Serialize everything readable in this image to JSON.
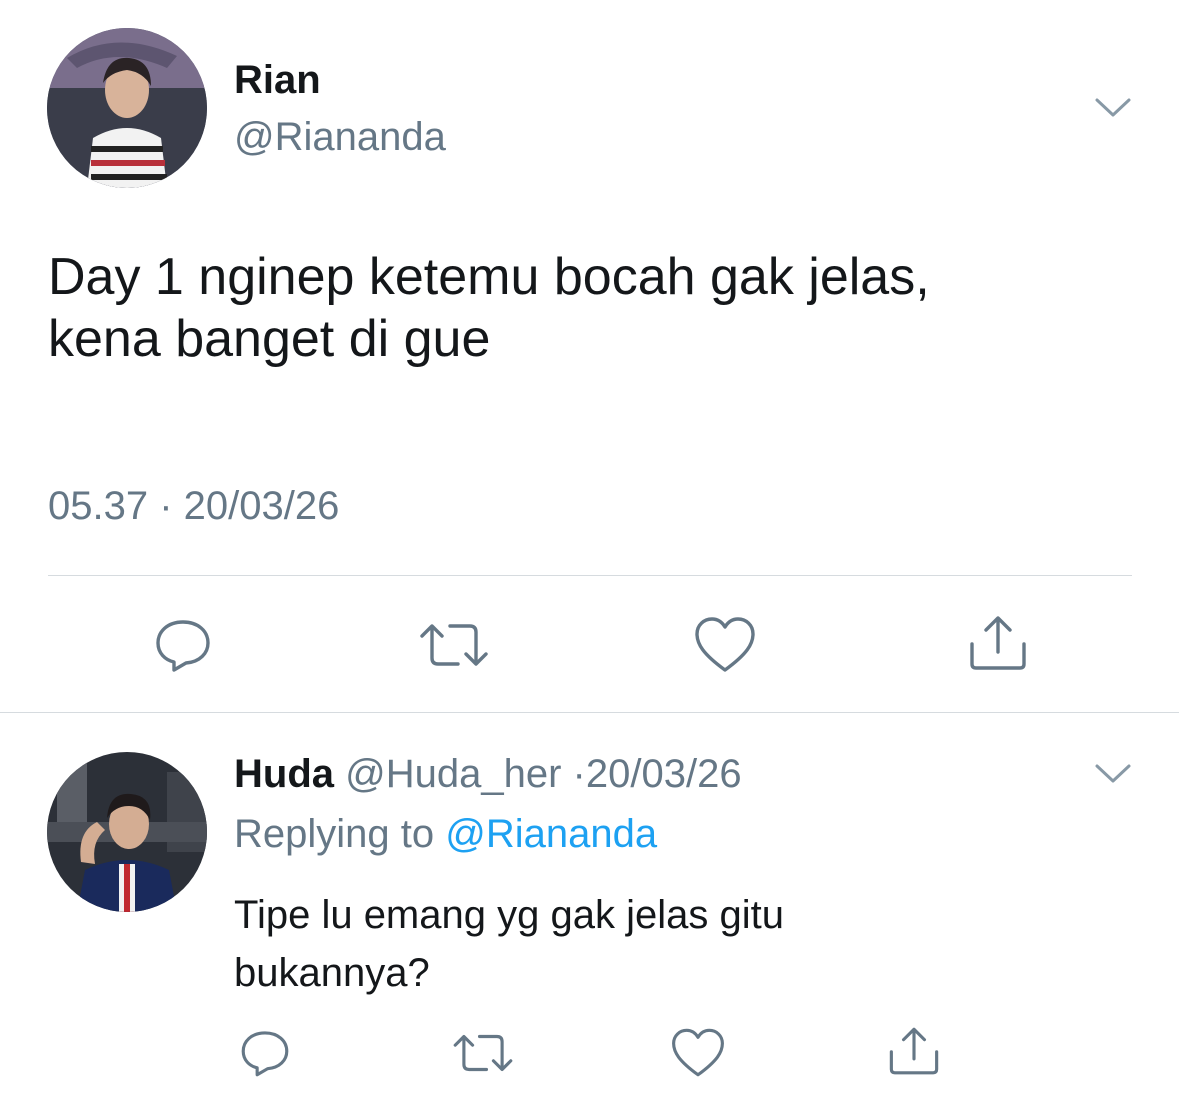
{
  "main_tweet": {
    "author_name": "Rian",
    "author_handle": "@Riananda",
    "text_line1": "Day 1 nginep ketemu bocah gak jelas,",
    "text_line2": "kena banget di gue",
    "timestamp": "05.37 · 20/03/26",
    "actions": [
      "reply-icon",
      "retweet-icon",
      "like-icon",
      "share-icon"
    ]
  },
  "reply_tweet": {
    "author_name": "Huda",
    "author_handle": "@Huda_her",
    "separator": "·",
    "date": "20/03/26",
    "replying_prefix": "Replying to",
    "replying_handle": "@Riananda",
    "text_line1": "Tipe lu emang yg gak jelas gitu",
    "text_line2": "bukannya?",
    "actions": [
      "reply-icon",
      "retweet-icon",
      "like-icon",
      "share-icon"
    ]
  },
  "colors": {
    "text_primary": "#14171a",
    "text_secondary": "#657786",
    "link": "#1da1f2",
    "divider": "#d6dbdf",
    "icon": "#657786"
  }
}
